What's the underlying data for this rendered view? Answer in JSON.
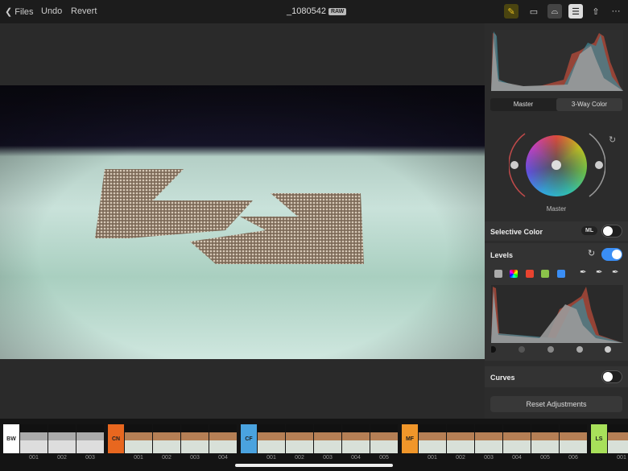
{
  "toolbar": {
    "back_label": "Files",
    "undo_label": "Undo",
    "revert_label": "Revert",
    "filename": "_1080542",
    "format_badge": "RAW",
    "icons": [
      "auto-adjust-icon",
      "healing-bandage-icon",
      "crop-icon",
      "adjustments-icon",
      "share-icon",
      "more-icon"
    ]
  },
  "panel": {
    "color_tabs": [
      "Master",
      "3-Way Color"
    ],
    "wheel_label": "Master",
    "selective_color": {
      "label": "Selective Color",
      "badge": "ML",
      "enabled": false
    },
    "levels": {
      "label": "Levels",
      "enabled": true
    },
    "curves": {
      "label": "Curves",
      "enabled": false
    },
    "reset_label": "Reset Adjustments",
    "colors": {
      "accent": "#3a8ef5",
      "red": "#e8432f",
      "green": "#8bc34a",
      "blue": "#3a8ef5"
    }
  },
  "filmstrip": [
    {
      "code": "BW",
      "color": "#ffffff",
      "items": [
        "001",
        "002",
        "003"
      ]
    },
    {
      "code": "CN",
      "color": "#e8671f",
      "items": [
        "001",
        "002",
        "003",
        "004"
      ]
    },
    {
      "code": "CF",
      "color": "#4aa3df",
      "items": [
        "001",
        "002",
        "003",
        "004",
        "005"
      ]
    },
    {
      "code": "MF",
      "color": "#f0962a",
      "items": [
        "001",
        "002",
        "003",
        "004",
        "005",
        "006"
      ]
    },
    {
      "code": "LS",
      "color": "#a8e05a",
      "items": [
        "001"
      ]
    }
  ]
}
